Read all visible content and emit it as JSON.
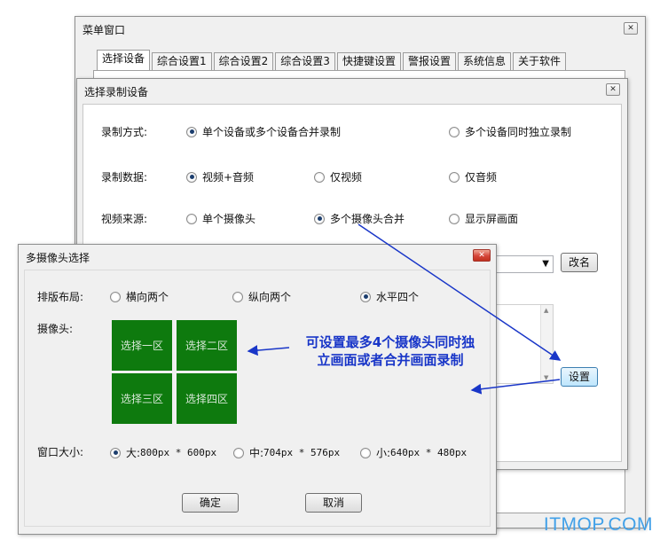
{
  "menu_window": {
    "title": "菜单窗口",
    "close_glyph": "✕",
    "tabs": [
      "选择设备",
      "综合设置1",
      "综合设置2",
      "综合设置3",
      "快捷键设置",
      "警报设置",
      "系统信息",
      "关于软件"
    ]
  },
  "device_dialog": {
    "title": "选择录制设备",
    "close_glyph": "✕",
    "record_mode": {
      "label": "录制方式:",
      "options": [
        "单个设备或多个设备合并录制",
        "多个设备同时独立录制"
      ],
      "selected": 0
    },
    "record_data": {
      "label": "录制数据:",
      "options": [
        "视频+音频",
        "仅视频",
        "仅音频"
      ],
      "selected": 0
    },
    "video_source": {
      "label": "视频来源:",
      "options": [
        "单个摄像头",
        "多个摄像头合并",
        "显示屏画面"
      ],
      "selected": 1
    },
    "rename_button": "改名",
    "settings_button": "设置",
    "dropdown_arrow": "▼",
    "scroll_up": "▲",
    "scroll_down": "▼"
  },
  "multi_cam_dialog": {
    "title": "多摄像头选择",
    "close_glyph": "✕",
    "layout": {
      "label": "排版布局:",
      "options": [
        "横向两个",
        "纵向两个",
        "水平四个"
      ],
      "selected": 2
    },
    "camera_label": "摄像头:",
    "zones": [
      "选择一区",
      "选择二区",
      "选择三区",
      "选择四区"
    ],
    "window_size": {
      "label": "窗口大小:",
      "options": [
        {
          "prefix": "大:",
          "value": "800px * 600px"
        },
        {
          "prefix": "中:",
          "value": "704px * 576px"
        },
        {
          "prefix": "小:",
          "value": "640px * 480px"
        }
      ],
      "selected": 0
    },
    "ok_button": "确定",
    "cancel_button": "取消"
  },
  "annotation": {
    "line1": "可设置最多4个摄像头同时独",
    "line2": "立画面或者合并画面录制",
    "color": "#1936c8"
  },
  "watermark": "ITMOP.COM"
}
